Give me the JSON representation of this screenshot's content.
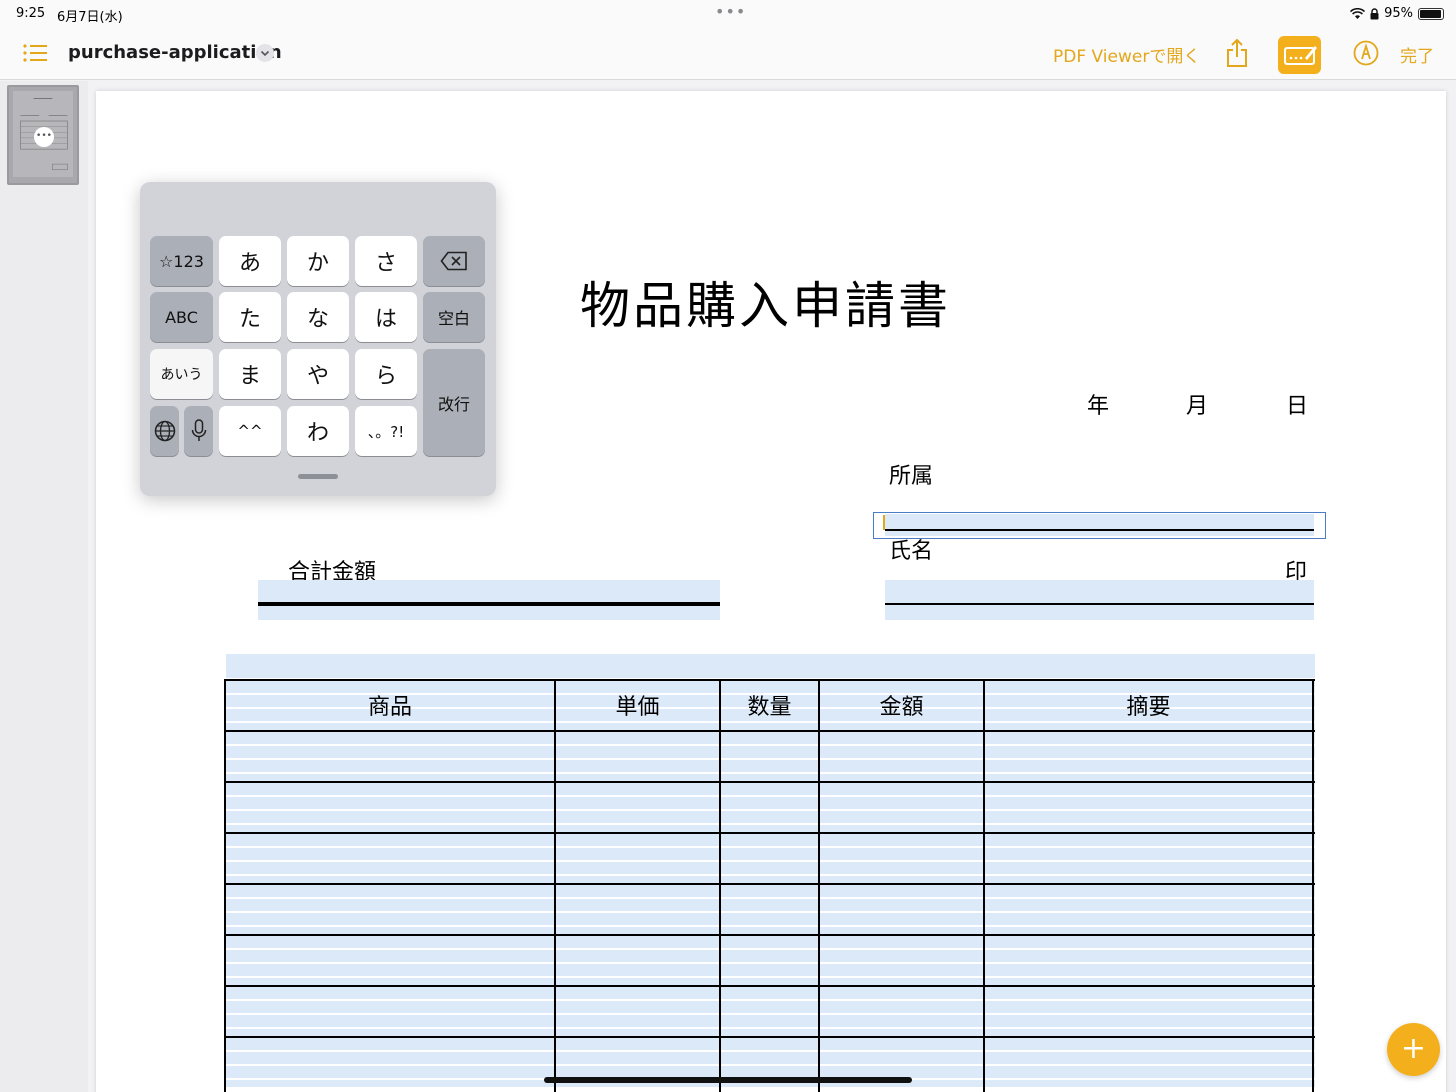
{
  "status": {
    "time": "9:25",
    "date": "6月7日(水)",
    "battery_text": "95%",
    "battery_level": 0.95
  },
  "toolbar": {
    "doc_title": "purchase-application",
    "open_in": "PDF Viewerで開く",
    "done": "完了",
    "icons": [
      "list-icon",
      "chevron-down-icon",
      "share-icon",
      "markup-icon",
      "pen-circle-icon"
    ]
  },
  "document": {
    "title": "物品購入申請書",
    "date_labels": {
      "year": "年",
      "month": "月",
      "day": "日"
    },
    "affiliation_label": "所属",
    "name_label": "氏名",
    "seal_label": "印",
    "total_label": "合計金額",
    "table_headers": [
      "商品",
      "単価",
      "数量",
      "金額",
      "摘要"
    ]
  },
  "keyboard": {
    "keys": {
      "sym123": "☆123",
      "abc": "ABC",
      "kana_mode": "あいう",
      "a": "あ",
      "ka": "か",
      "sa": "さ",
      "ta": "た",
      "na": "な",
      "ha": "は",
      "ma": "ま",
      "ya": "や",
      "ra": "ら",
      "face": "^^",
      "wa": "わ",
      "punct": "、。?!",
      "space": "空白",
      "enter": "改行"
    }
  },
  "fab": {
    "label": "+"
  },
  "colors": {
    "accent": "#f3b01c",
    "field_fill": "#dce9f9",
    "selection": "#4a7cc4"
  }
}
